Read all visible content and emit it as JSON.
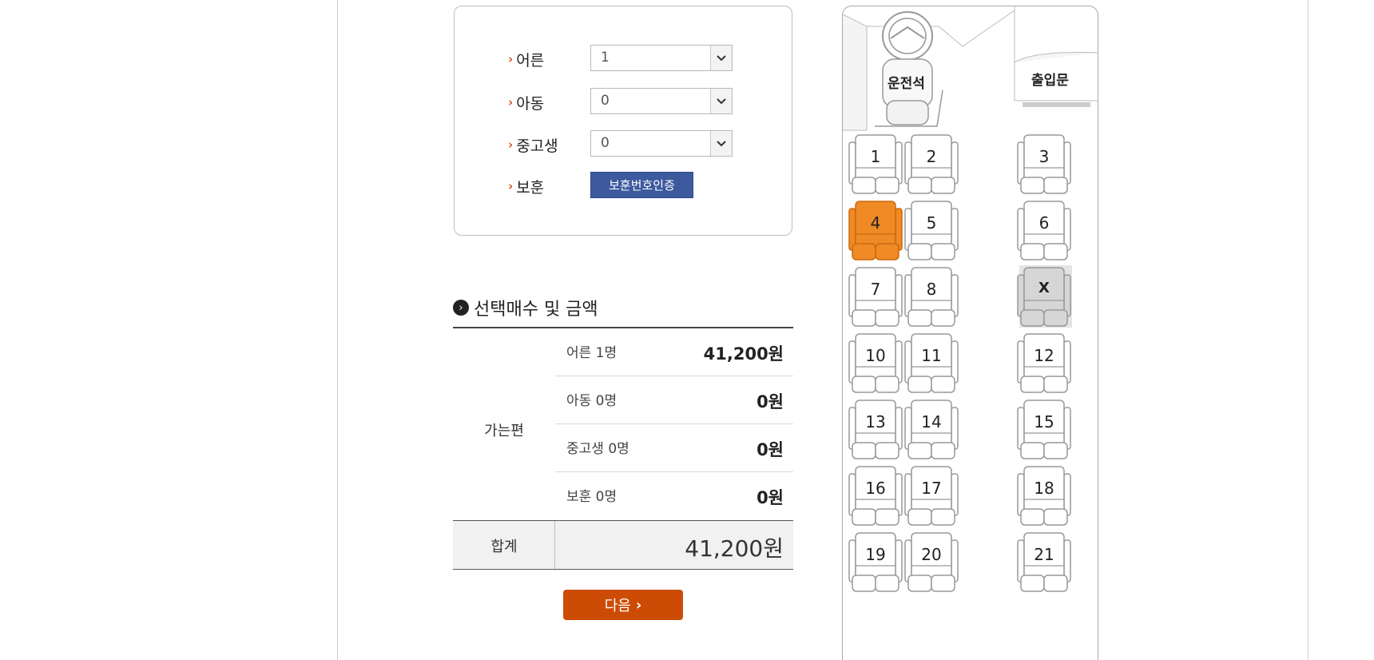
{
  "passengers": {
    "adult": {
      "label": "어른",
      "value": "1"
    },
    "child": {
      "label": "아동",
      "value": "0"
    },
    "teen": {
      "label": "중고생",
      "value": "0"
    },
    "veteran": {
      "label": "보훈",
      "button": "보훈번호인증"
    }
  },
  "summary": {
    "title": "선택매수 및 금액",
    "direction": "가는편",
    "rows": [
      {
        "name": "어른 1명",
        "amount": "41,200원"
      },
      {
        "name": "아동 0명",
        "amount": "0원"
      },
      {
        "name": "중고생 0명",
        "amount": "0원"
      },
      {
        "name": "보훈 0명",
        "amount": "0원"
      }
    ],
    "total_label": "합계",
    "total_amount": "41,200원"
  },
  "next_button": "다음",
  "bus": {
    "driver_label": "운전석",
    "door_label": "출입문",
    "seats": [
      {
        "label": "1",
        "state": "available"
      },
      {
        "label": "2",
        "state": "available"
      },
      {
        "label": "3",
        "state": "available"
      },
      {
        "label": "4",
        "state": "selected"
      },
      {
        "label": "5",
        "state": "available"
      },
      {
        "label": "6",
        "state": "available"
      },
      {
        "label": "7",
        "state": "available"
      },
      {
        "label": "8",
        "state": "available"
      },
      {
        "label": "X",
        "state": "sold"
      },
      {
        "label": "10",
        "state": "available"
      },
      {
        "label": "11",
        "state": "available"
      },
      {
        "label": "12",
        "state": "available"
      },
      {
        "label": "13",
        "state": "available"
      },
      {
        "label": "14",
        "state": "available"
      },
      {
        "label": "15",
        "state": "available"
      },
      {
        "label": "16",
        "state": "available"
      },
      {
        "label": "17",
        "state": "available"
      },
      {
        "label": "18",
        "state": "available"
      },
      {
        "label": "19",
        "state": "available"
      },
      {
        "label": "20",
        "state": "available"
      },
      {
        "label": "21",
        "state": "available"
      }
    ],
    "colors": {
      "selected": "#f08a24",
      "sold": "#d6d6d6",
      "available": "#ffffff"
    }
  }
}
